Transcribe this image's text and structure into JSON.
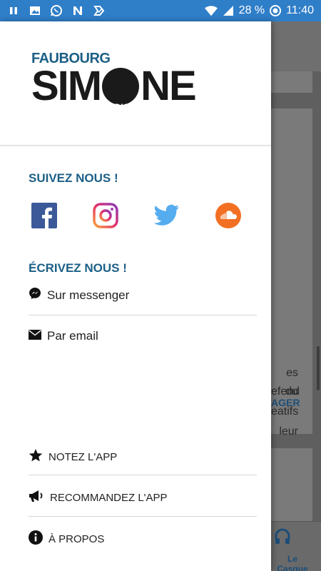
{
  "status_bar": {
    "battery": "28 %",
    "time": "11:40"
  },
  "drawer": {
    "logo": {
      "top": "FAUBOURG",
      "main_left": "SIM",
      "main_center": "LA RADIO",
      "main_right": "NE"
    },
    "follow_title": "SUIVEZ NOUS !",
    "social": [
      "facebook-icon",
      "instagram-icon",
      "twitter-icon",
      "soundcloud-icon"
    ],
    "write_title": "ÉCRIVEZ NOUS !",
    "contact": {
      "messenger": "Sur messenger",
      "email": "Par email"
    },
    "bottom": {
      "rate": "NOTEZ L'APP",
      "recommend": "RECOMMANDEZ L'APP",
      "about": "À PROPOS"
    }
  },
  "background": {
    "text_lines": [
      "es du",
      "efend",
      "eatifs",
      "leur"
    ],
    "action": "AGER",
    "nav_label": "Le Casque"
  },
  "colors": {
    "status_bar": "#2f7ec8",
    "accent": "#1c5f86"
  }
}
